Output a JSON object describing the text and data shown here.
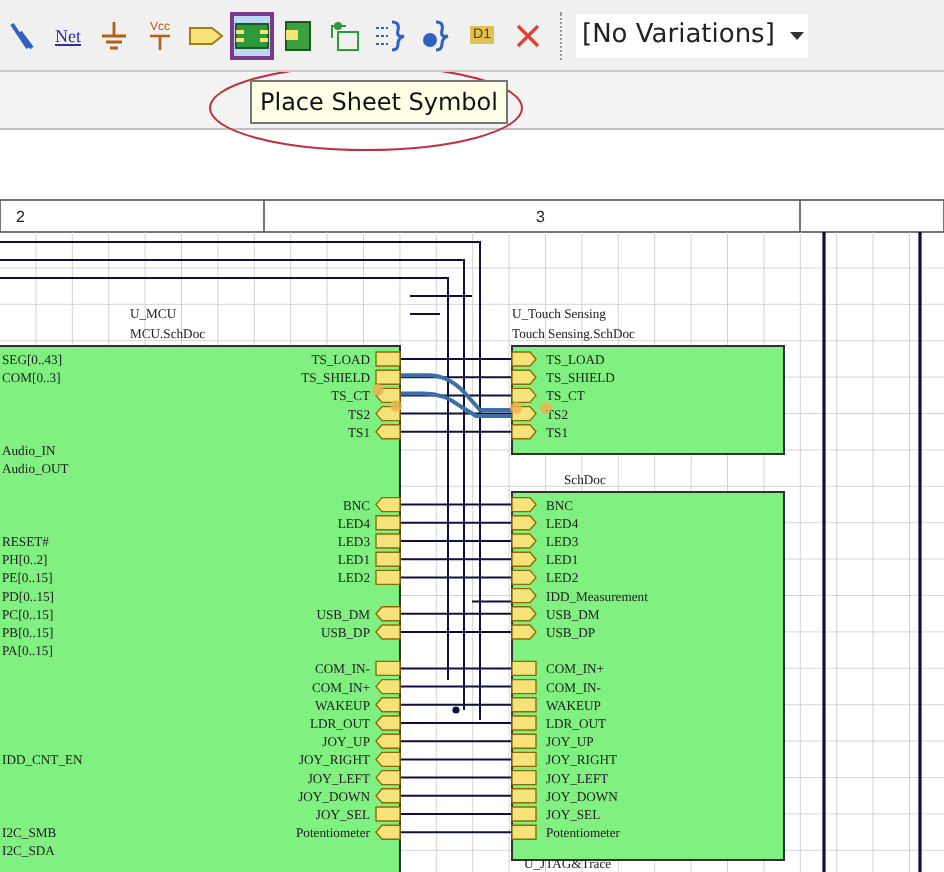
{
  "toolbar": {
    "tools": [
      {
        "kind": "wire",
        "selected": false
      },
      {
        "kind": "net-label",
        "label": "Net",
        "selected": false
      },
      {
        "kind": "ground",
        "selected": false
      },
      {
        "kind": "power",
        "label": "Vcc",
        "selected": false
      },
      {
        "kind": "port",
        "selected": false
      },
      {
        "kind": "sheet-symbol",
        "selected": true
      },
      {
        "kind": "sheet-entry",
        "selected": false
      },
      {
        "kind": "device-sheet",
        "selected": false
      },
      {
        "kind": "harness-connector",
        "selected": false
      },
      {
        "kind": "harness-entry",
        "selected": false
      },
      {
        "kind": "parameter-set",
        "label": "D1",
        "selected": false
      },
      {
        "kind": "no-erc",
        "selected": false
      }
    ],
    "variations": "[No Variations]"
  },
  "tooltip": "Place Sheet Symbol",
  "ruler": [
    "2",
    "3"
  ],
  "sheets": [
    {
      "designator": "U_MCU",
      "filename": "MCU.SchDoc",
      "left_entries": [
        {
          "name": "SEG[0..43]"
        },
        {
          "name": "COM[0..3]"
        },
        {
          "name": "Audio_IN"
        },
        {
          "name": "Audio_OUT"
        },
        {
          "name": "RESET#"
        },
        {
          "name": "PH[0..2]"
        },
        {
          "name": "PE[0..15]"
        },
        {
          "name": "PD[0..15]"
        },
        {
          "name": "PC[0..15]"
        },
        {
          "name": "PB[0..15]"
        },
        {
          "name": "PA[0..15]"
        },
        {
          "name": "IDD_CNT_EN"
        },
        {
          "name": "I2C_SMB"
        },
        {
          "name": "I2C_SDA"
        }
      ],
      "right_entries": [
        {
          "name": "TS_LOAD",
          "kind": "box"
        },
        {
          "name": "TS_SHIELD",
          "kind": "box"
        },
        {
          "name": "TS_CT",
          "kind": "left"
        },
        {
          "name": "TS2",
          "kind": "left"
        },
        {
          "name": "TS1",
          "kind": "left"
        },
        {
          "name": "BNC",
          "kind": "left"
        },
        {
          "name": "LED4",
          "kind": "box"
        },
        {
          "name": "LED3",
          "kind": "box"
        },
        {
          "name": "LED1",
          "kind": "box"
        },
        {
          "name": "LED2",
          "kind": "box"
        },
        {
          "name": "USB_DM",
          "kind": "left"
        },
        {
          "name": "USB_DP",
          "kind": "left"
        },
        {
          "name": "COM_IN-",
          "kind": "box"
        },
        {
          "name": "COM_IN+",
          "kind": "left"
        },
        {
          "name": "WAKEUP",
          "kind": "left"
        },
        {
          "name": "LDR_OUT",
          "kind": "left"
        },
        {
          "name": "JOY_UP",
          "kind": "left"
        },
        {
          "name": "JOY_RIGHT",
          "kind": "left"
        },
        {
          "name": "JOY_LEFT",
          "kind": "left"
        },
        {
          "name": "JOY_DOWN",
          "kind": "left"
        },
        {
          "name": "JOY_SEL",
          "kind": "box"
        },
        {
          "name": "Potentiometer",
          "kind": "left"
        }
      ]
    },
    {
      "designator": "U_Touch Sensing",
      "filename": "Touch Sensing.SchDoc",
      "left_entries": [
        {
          "name": "TS_LOAD",
          "kind": "right"
        },
        {
          "name": "TS_SHIELD",
          "kind": "right"
        },
        {
          "name": "TS_CT",
          "kind": "right"
        },
        {
          "name": "TS2",
          "kind": "right"
        },
        {
          "name": "TS1",
          "kind": "right"
        }
      ]
    },
    {
      "filename": "SchDoc",
      "left_entries": [
        {
          "name": "BNC",
          "kind": "right"
        },
        {
          "name": "LED4",
          "kind": "right"
        },
        {
          "name": "LED3",
          "kind": "right"
        },
        {
          "name": "LED1",
          "kind": "right"
        },
        {
          "name": "LED2",
          "kind": "right"
        },
        {
          "name": "IDD_Measurement",
          "kind": "right"
        },
        {
          "name": "USB_DM",
          "kind": "right"
        },
        {
          "name": "USB_DP",
          "kind": "right"
        },
        {
          "name": "COM_IN+",
          "kind": "box"
        },
        {
          "name": "COM_IN-",
          "kind": "box"
        },
        {
          "name": "WAKEUP",
          "kind": "box"
        },
        {
          "name": "LDR_OUT",
          "kind": "box"
        },
        {
          "name": "JOY_UP",
          "kind": "box"
        },
        {
          "name": "JOY_RIGHT",
          "kind": "box"
        },
        {
          "name": "JOY_LEFT",
          "kind": "box"
        },
        {
          "name": "JOY_DOWN",
          "kind": "box"
        },
        {
          "name": "JOY_SEL",
          "kind": "box"
        },
        {
          "name": "Potentiometer",
          "kind": "box"
        }
      ]
    },
    {
      "designator": "U_JTAG&Trace"
    }
  ]
}
